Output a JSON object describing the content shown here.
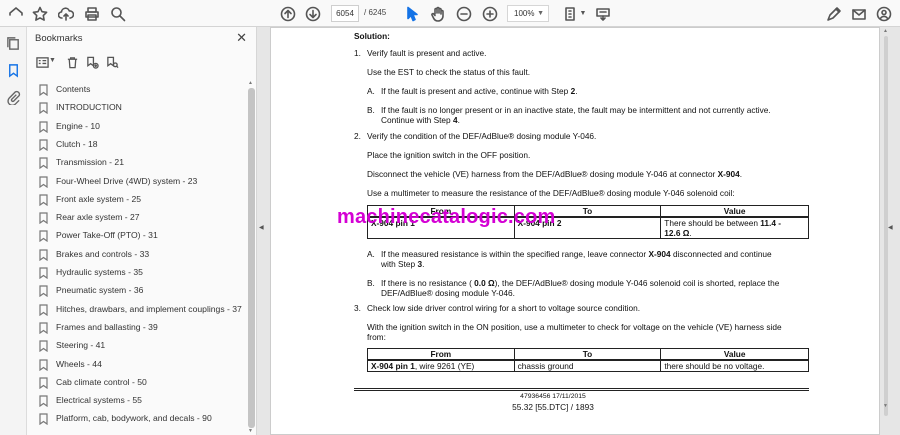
{
  "toolbar": {
    "current_page": "6054",
    "total_pages": "/ 6245",
    "zoom": "100%"
  },
  "bookmarks_panel": {
    "title": "Bookmarks",
    "items": [
      "Contents",
      "INTRODUCTION",
      "Engine - 10",
      "Clutch - 18",
      "Transmission - 21",
      "Four-Wheel Drive (4WD) system - 23",
      "Front axle system - 25",
      "Rear axle system - 27",
      "Power Take-Off (PTO) - 31",
      "Brakes and controls - 33",
      "Hydraulic systems - 35",
      "Pneumatic system - 36",
      "Hitches, drawbars, and implement couplings - 37",
      "Frames and ballasting - 39",
      "Steering - 41",
      "Wheels - 44",
      "Cab climate control - 50",
      "Electrical systems - 55",
      "Platform, cab, bodywork, and decals - 90"
    ]
  },
  "document": {
    "solution_heading": "Solution:",
    "step1_num": "1.",
    "step1": "Verify fault is present and active.",
    "step1_sub": "Use the EST to check the status of this fault.",
    "step1_a_letter": "A.",
    "step1_a": "If the fault is present and active, continue with Step ",
    "step1_a_bold": "2",
    "step1_a_end": ".",
    "step1_b_letter": "B.",
    "step1_b_line1": "If the fault is no longer present or in an inactive state, the fault may be intermittent and not currently active.",
    "step1_b_line2": "Continue with Step ",
    "step1_b_bold": "4",
    "step1_b_end": ".",
    "step2_num": "2.",
    "step2": "Verify the condition of the DEF/AdBlue® dosing module Y-046.",
    "step2_p1": "Place the ignition switch in the OFF position.",
    "step2_p2": "Disconnect the vehicle (VE) harness from the DEF/AdBlue® dosing module Y-046 at connector ",
    "step2_p2_bold": "X-904",
    "step2_p2_end": ".",
    "step2_p3": "Use a multimeter to measure the resistance of the DEF/AdBlue® dosing module Y-046 solenoid coil:",
    "table1": {
      "headers": [
        "From",
        "To",
        "Value"
      ],
      "from": "X-904 pin 1",
      "to": "X-904 pin 2",
      "value_line1_pre": "There should be between ",
      "value_line1_bold": "11.4 -",
      "value_line2_bold": "12.6 Ω",
      "value_line2_end": "."
    },
    "step2_a_letter": "A.",
    "step2_a_pre": "If the measured resistance is within the specified range, leave connector ",
    "step2_a_bold": "X-904",
    "step2_a_post": " disconnected and continue",
    "step2_a_line2_pre": "with Step ",
    "step2_a_line2_bold": "3",
    "step2_a_line2_end": ".",
    "step2_b_letter": "B.",
    "step2_b_pre": "If there is no resistance ( ",
    "step2_b_bold": "0.0 Ω",
    "step2_b_post": "), the DEF/AdBlue® dosing module Y-046 solenoid coil is shorted, replace the",
    "step2_b_line2": "DEF/AdBlue® dosing module Y-046.",
    "step3_num": "3.",
    "step3": "Check low side driver control wiring for a short to voltage source condition.",
    "step3_p1_line1": "With the ignition switch in the ON position, use a multimeter to check for voltage on the vehicle (VE) harness side",
    "step3_p1_line2": "from:",
    "table2": {
      "headers": [
        "From",
        "To",
        "Value"
      ],
      "from_bold": "X-904 pin 1",
      "from_rest": ", wire 9261 (YE)",
      "to": "chassis ground",
      "value": "there should be no voltage."
    },
    "footer_code": "47936456 17/11/2015",
    "footer_page": "55.32 [55.DTC] / 1893"
  },
  "watermark": "machinecatalogic.com",
  "colors": {
    "watermark": "#d400d4",
    "accent": "#1473e6"
  }
}
